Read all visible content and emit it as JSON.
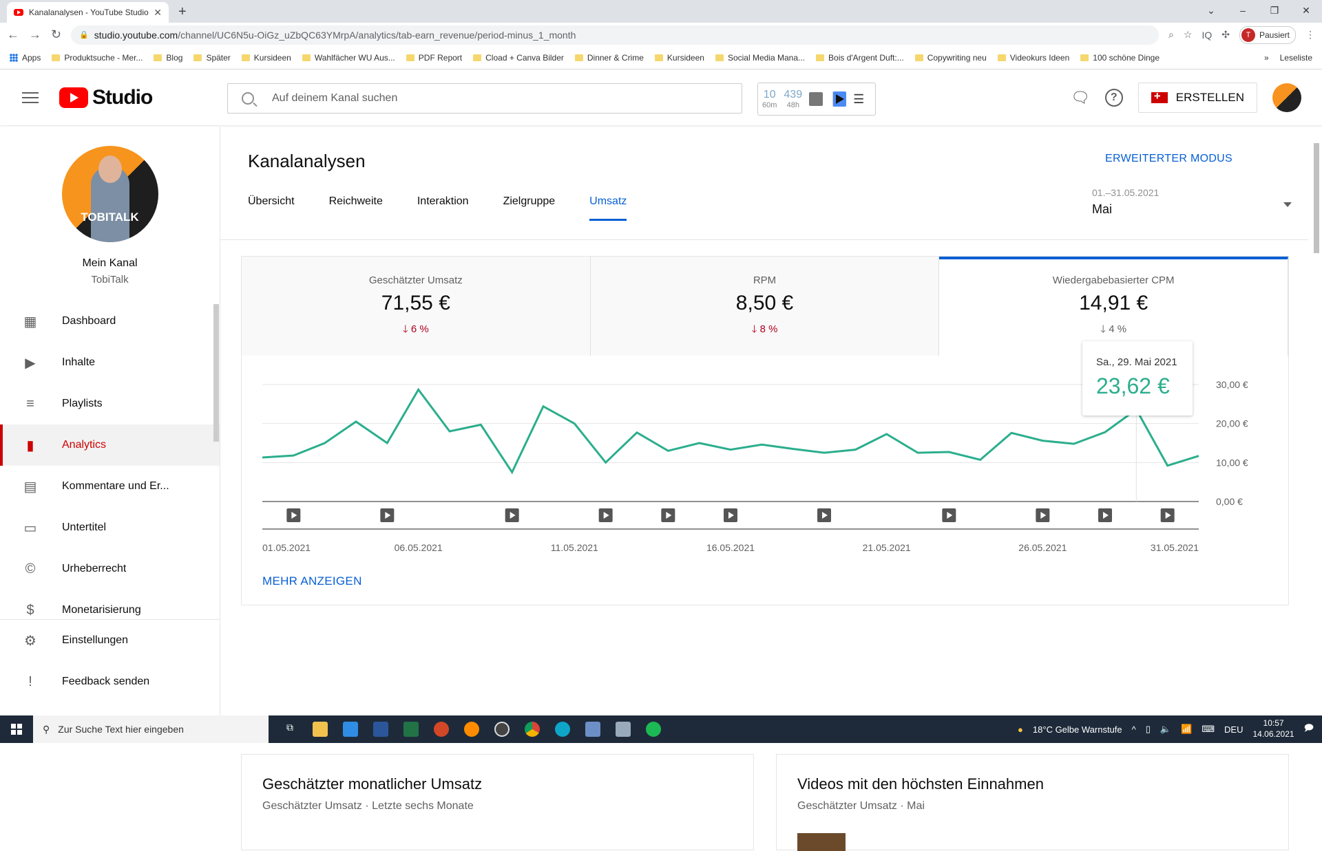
{
  "browser": {
    "tab_title": "Kanalanalysen - YouTube Studio",
    "url_host": "studio.youtube.com",
    "url_path": "/channel/UC6N5u-OiGz_uZbQC63YMrpA/analytics/tab-earn_revenue/period-minus_1_month",
    "profile_status": "Pausiert",
    "profile_initial": "T",
    "bookmarks": [
      "Apps",
      "Produktsuche - Mer...",
      "Blog",
      "Später",
      "Kursideen",
      "Wahlfächer WU Aus...",
      "PDF Report",
      "Cload + Canva Bilder",
      "Dinner & Crime",
      "Kursideen",
      "Social Media Mana...",
      "Bois d'Argent Duft:...",
      "Copywriting neu",
      "Videokurs Ideen",
      "100 schöne Dinge"
    ],
    "reading_list": "Leseliste"
  },
  "header": {
    "logo_text": "Studio",
    "search_placeholder": "Auf deinem Kanal suchen",
    "ext_stats": [
      {
        "value": "10",
        "sub": "60m"
      },
      {
        "value": "439",
        "sub": "48h"
      }
    ],
    "create_label": "ERSTELLEN"
  },
  "sidebar": {
    "channel_label": "Mein Kanal",
    "channel_name": "TobiTalk",
    "avatar_text": "TOBITALK",
    "items": [
      {
        "label": "Dashboard",
        "icon": "dashboard-icon"
      },
      {
        "label": "Inhalte",
        "icon": "content-icon"
      },
      {
        "label": "Playlists",
        "icon": "playlist-icon"
      },
      {
        "label": "Analytics",
        "icon": "analytics-icon",
        "active": true
      },
      {
        "label": "Kommentare und Er...",
        "icon": "comments-icon"
      },
      {
        "label": "Untertitel",
        "icon": "subtitles-icon"
      },
      {
        "label": "Urheberrecht",
        "icon": "copyright-icon"
      },
      {
        "label": "Monetarisierung",
        "icon": "monetization-icon"
      }
    ],
    "bottom_items": [
      {
        "label": "Einstellungen",
        "icon": "gear-icon"
      },
      {
        "label": "Feedback senden",
        "icon": "feedback-icon"
      }
    ]
  },
  "main": {
    "title": "Kanalanalysen",
    "advanced_mode": "ERWEITERTER MODUS",
    "tabs": [
      "Übersicht",
      "Reichweite",
      "Interaktion",
      "Zielgruppe",
      "Umsatz"
    ],
    "active_tab": "Umsatz",
    "period_range": "01.–31.05.2021",
    "period_label": "Mai",
    "metrics": [
      {
        "label": "Geschätzter Umsatz",
        "value": "71,55 €",
        "change": "6 %",
        "direction": "down"
      },
      {
        "label": "RPM",
        "value": "8,50 €",
        "change": "8 %",
        "direction": "down"
      },
      {
        "label": "Wiedergabebasierter CPM",
        "value": "14,91 €",
        "change": "4 %",
        "direction": "down",
        "selected": true
      }
    ],
    "more_label": "MEHR ANZEIGEN",
    "tooltip": {
      "date": "Sa., 29. Mai 2021",
      "value": "23,62 €"
    },
    "cards": [
      {
        "title": "Geschätzter monatlicher Umsatz",
        "subtitle": "Geschätzter Umsatz · Letzte sechs Monate"
      },
      {
        "title": "Videos mit den höchsten Einnahmen",
        "subtitle": "Geschätzter Umsatz · Mai"
      }
    ]
  },
  "colors": {
    "accent": "#065fd4",
    "line": "#2bae8d",
    "negative": "#b0001e",
    "active_nav": "#cc0000"
  },
  "chart_data": {
    "type": "line",
    "title": "Wiedergabebasierter CPM",
    "xlabel": "",
    "ylabel": "",
    "x": [
      "01.05",
      "02.05",
      "03.05",
      "04.05",
      "05.05",
      "06.05",
      "07.05",
      "08.05",
      "09.05",
      "10.05",
      "11.05",
      "12.05",
      "13.05",
      "14.05",
      "15.05",
      "16.05",
      "17.05",
      "18.05",
      "19.05",
      "20.05",
      "21.05",
      "22.05",
      "23.05",
      "24.05",
      "25.05",
      "26.05",
      "27.05",
      "28.05",
      "29.05",
      "30.05",
      "31.05"
    ],
    "values": [
      11.3,
      11.8,
      15.0,
      20.5,
      15.0,
      28.7,
      18.0,
      19.7,
      7.5,
      24.4,
      20.0,
      10.0,
      17.7,
      13.0,
      15.0,
      13.3,
      14.6,
      13.5,
      12.5,
      13.3,
      17.3,
      12.5,
      12.7,
      10.7,
      17.6,
      15.6,
      14.8,
      17.8,
      23.62,
      9.2,
      11.7
    ],
    "x_tick_labels": [
      "01.05.2021",
      "06.05.2021",
      "11.05.2021",
      "16.05.2021",
      "21.05.2021",
      "26.05.2021",
      "31.05.2021"
    ],
    "y_tick_labels": [
      "0,00 €",
      "10,00 €",
      "20,00 €",
      "30,00 €"
    ],
    "ylim": [
      0,
      30
    ],
    "grid": true,
    "y_axis_side": "right",
    "video_markers_days": [
      2,
      5,
      9,
      12,
      14,
      16,
      19,
      23,
      26,
      28,
      30
    ],
    "highlighted_point": {
      "x": "29.05",
      "value": 23.62
    }
  },
  "taskbar": {
    "search_placeholder": "Zur Suche Text hier eingeben",
    "weather": "18°C  Gelbe Warnstufe",
    "lang": "DEU",
    "time": "10:57",
    "date": "14.06.2021"
  }
}
